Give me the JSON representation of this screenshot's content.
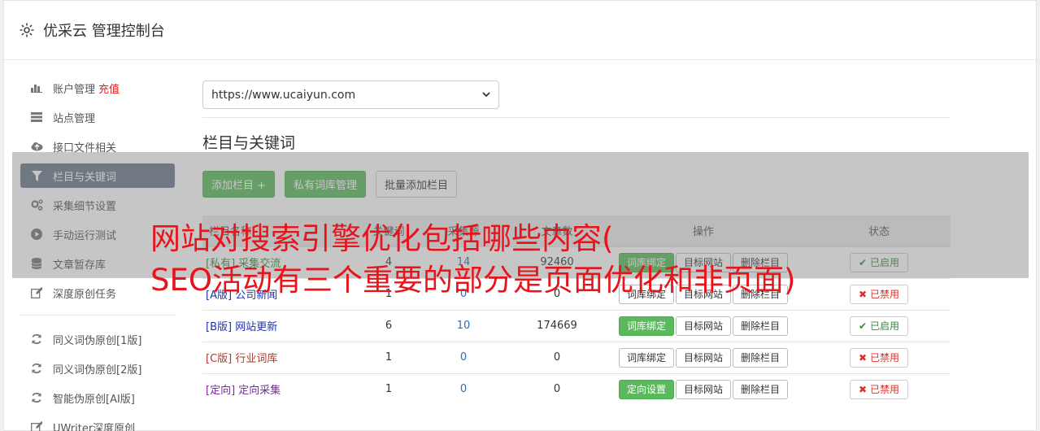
{
  "header": {
    "title": "优采云 管理控制台",
    "icon": "gear-icon"
  },
  "sidebar": {
    "items": [
      {
        "label": "账户管理",
        "extra": "充值",
        "icon": "bar-chart-icon"
      },
      {
        "label": "站点管理",
        "icon": "server-icon"
      },
      {
        "label": "接口文件相关",
        "icon": "cloud-upload-icon"
      },
      {
        "label": "栏目与关键词",
        "icon": "filter-icon",
        "active": true
      },
      {
        "label": "采集细节设置",
        "icon": "gears-icon"
      },
      {
        "label": "手动运行测试",
        "icon": "play-circle-icon"
      },
      {
        "label": "文章暂存库",
        "icon": "database-icon"
      },
      {
        "label": "深度原创任务",
        "icon": "edit-icon"
      }
    ],
    "items2": [
      {
        "label": "同义词伪原创[1版]",
        "icon": "refresh-icon"
      },
      {
        "label": "同义词伪原创[2版]",
        "icon": "refresh-icon"
      },
      {
        "label": "智能伪原创[AI版]",
        "icon": "refresh-icon"
      },
      {
        "label": "UWriter深度原创",
        "icon": "edit-icon"
      }
    ]
  },
  "main": {
    "site_select": "https://www.ucaiyun.com",
    "section_title": "栏目与关键词",
    "toolbar": {
      "add_column": "添加栏目 +",
      "private_library": "私有词库管理",
      "batch_add": "批量添加栏目"
    },
    "table": {
      "headers": [
        "栏目名称",
        "关键词",
        "采集源",
        "文章数",
        "操作",
        "状态"
      ],
      "rows": [
        {
          "tag": "[私有]",
          "name": "采集交流",
          "a": "4",
          "b": "14",
          "c": "92460",
          "action1": "词库绑定",
          "action2": "目标网站",
          "action3": "删除栏目",
          "status": "已启用",
          "on": true,
          "tagcolor": "green"
        },
        {
          "tag": "[A版]",
          "name": "公司新闻",
          "a": "1",
          "b": "0",
          "c": "0",
          "action1": "词库绑定",
          "action2": "目标网站",
          "action3": "删除栏目",
          "status": "已禁用",
          "on": false,
          "tagcolor": "blue"
        },
        {
          "tag": "[B版]",
          "name": "网站更新",
          "a": "6",
          "b": "10",
          "c": "174669",
          "action1": "词库绑定",
          "action2": "目标网站",
          "action3": "删除栏目",
          "status": "已启用",
          "on": true,
          "tagcolor": "blue"
        },
        {
          "tag": "[C版]",
          "name": "行业词库",
          "a": "1",
          "b": "0",
          "c": "0",
          "action1": "词库绑定",
          "action2": "目标网站",
          "action3": "删除栏目",
          "status": "已禁用",
          "on": false,
          "tagcolor": "red"
        },
        {
          "tag": "[定向]",
          "name": "定向采集",
          "a": "1",
          "b": "0",
          "c": "0",
          "action1": "定向设置",
          "action2": "目标网站",
          "action3": "删除栏目",
          "status": "已禁用",
          "on": false,
          "tagcolor": "purple"
        }
      ]
    }
  },
  "overlay": {
    "headline_line1": "网站对搜索引擎优化包括哪些内容(",
    "headline_line2": "SEO活动有三个重要的部分是页面优化和非页面)"
  },
  "colors": {
    "accent_green": "#5cb85c",
    "active_nav": "#6b7a8c",
    "headline_red": "#e8141b"
  }
}
